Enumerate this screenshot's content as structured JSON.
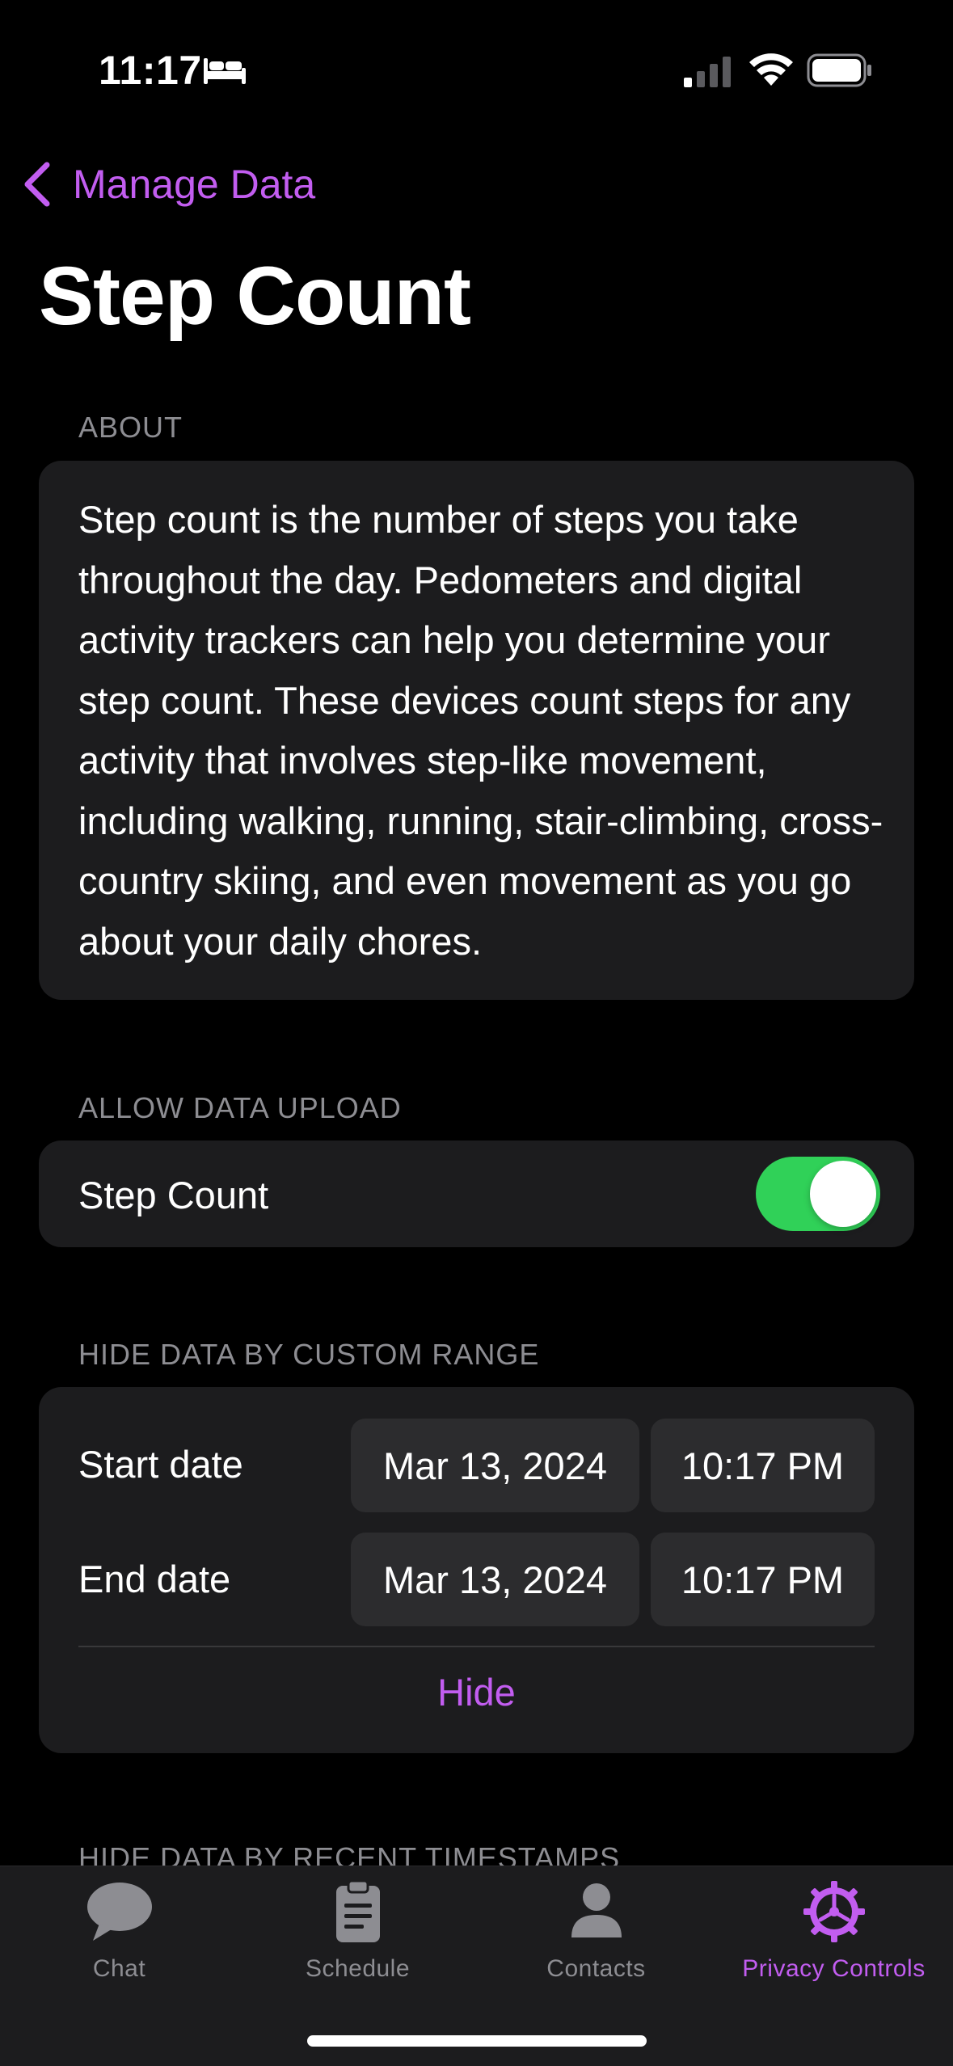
{
  "status_bar": {
    "time": "11:17",
    "focus_icon": "bed-icon",
    "signal_icon": "cellular-signal-icon",
    "wifi_icon": "wifi-icon",
    "battery_icon": "battery-icon"
  },
  "nav": {
    "back_label": "Manage Data",
    "back_icon": "chevron-left-icon"
  },
  "page": {
    "title": "Step Count"
  },
  "about": {
    "header": "ABOUT",
    "text": "Step count is the number of steps you take throughout the day. Pedometers and digital activity trackers can help you determine your step count. These devices count steps for any activity that involves step-like movement, including walking, running, stair-climbing, cross-country skiing, and even movement as you go about your daily chores."
  },
  "allow_upload": {
    "header": "ALLOW DATA UPLOAD",
    "label": "Step Count",
    "enabled": true
  },
  "custom_range": {
    "header": "HIDE DATA BY CUSTOM RANGE",
    "start_label": "Start date",
    "start_date": "Mar 13, 2024",
    "start_time": "10:17 PM",
    "end_label": "End date",
    "end_date": "Mar 13, 2024",
    "end_time": "10:17 PM",
    "hide_label": "Hide"
  },
  "next_section_header": "HIDE DATA BY RECENT TIMESTAMPS",
  "tabs": [
    {
      "label": "Chat",
      "icon": "chat-bubble-icon",
      "active": false
    },
    {
      "label": "Schedule",
      "icon": "clipboard-icon",
      "active": false
    },
    {
      "label": "Contacts",
      "icon": "person-icon",
      "active": false
    },
    {
      "label": "Privacy Controls",
      "icon": "gear-icon",
      "active": true
    }
  ],
  "colors": {
    "accent": "#c25df0",
    "toggle_on": "#30d158",
    "card_bg": "#1c1c1e",
    "secondary_text": "#8d8d92"
  }
}
